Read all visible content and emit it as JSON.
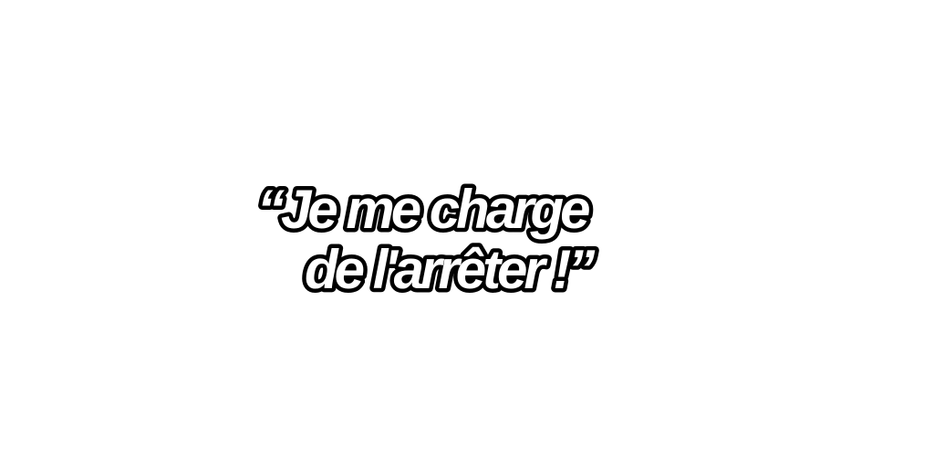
{
  "caption": {
    "line1": "“Je me charge",
    "line2": "de l'arrêter !”"
  },
  "colors": {
    "background": "#ffffff",
    "text_fill": "#ffffff",
    "text_outline": "#000000"
  }
}
